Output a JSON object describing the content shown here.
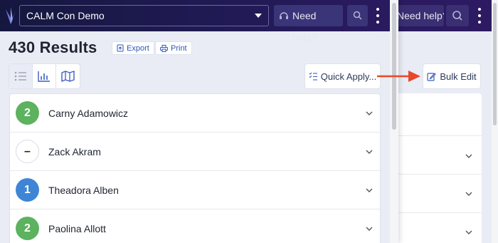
{
  "header": {
    "org_name": "CALM Con Demo",
    "help_label": "Need help?",
    "background_help_label": "Need help?"
  },
  "results": {
    "title": "430 Results",
    "export_label": "Export",
    "print_label": "Print"
  },
  "toolbar": {
    "quick_apply_label": "Quick Apply...",
    "bulk_edit_label": "Bulk Edit",
    "views": [
      "list-view",
      "chart-view",
      "map-view"
    ]
  },
  "people": [
    {
      "badge": "2",
      "name": "Carny Adamowicz",
      "color": "green"
    },
    {
      "badge": "–",
      "name": "Zack Akram",
      "color": "empty"
    },
    {
      "badge": "1",
      "name": "Theadora Alben",
      "color": "blue"
    },
    {
      "badge": "2",
      "name": "Paolina Allott",
      "color": "green"
    }
  ],
  "colors": {
    "topbar": "#1f1a52",
    "accent_link": "#2e55b8",
    "arrow": "#e8472b",
    "badge_green": "#5cb25f",
    "badge_blue": "#3e85d6"
  }
}
